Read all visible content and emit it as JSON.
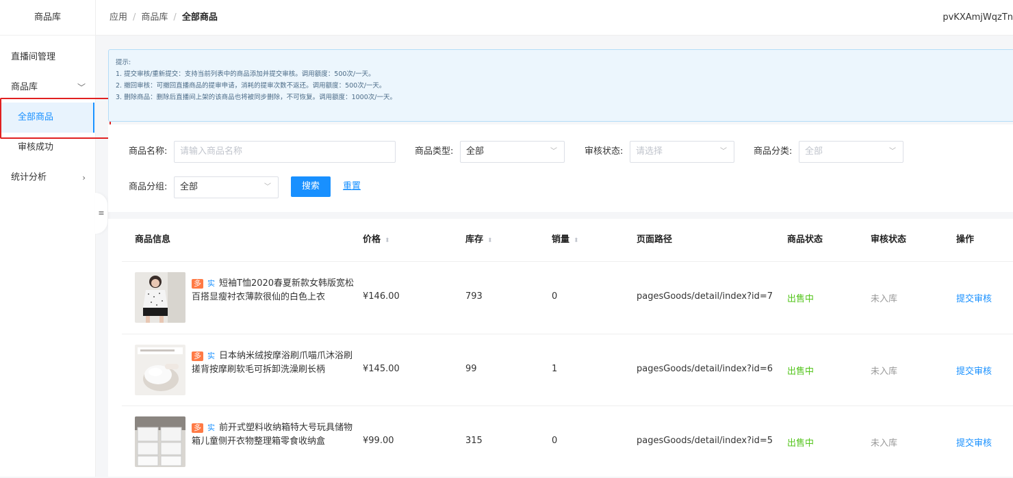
{
  "sidebar": {
    "title": "商品库",
    "items": [
      {
        "label": "直播间管理"
      },
      {
        "label": "商品库",
        "arrow": "﹀"
      },
      {
        "label": "全部商品"
      },
      {
        "label": "审核成功"
      },
      {
        "label": "统计分析",
        "arrow": "›"
      }
    ],
    "collapse_icon": "≡"
  },
  "header": {
    "breadcrumb": [
      "应用",
      "商品库",
      "全部商品"
    ],
    "separator": "/",
    "account": "pvKXAmjWqzTn"
  },
  "tips": {
    "title": "提示:",
    "lines": [
      "1. 提交审核/重新提交：支持当前列表中的商品添加并提交审核。调用额度：500次/一天。",
      "2. 撤回审核：可撤回直播商品的提审申请，消耗的提审次数不返还。调用额度：500次/一天。",
      "3. 删除商品：删除后直播间上架的该商品也将被同步删除，不可恢复。调用额度：1000次/一天。"
    ]
  },
  "filters": {
    "name_label": "商品名称:",
    "name_placeholder": "请输入商品名称",
    "type_label": "商品类型:",
    "type_value": "全部",
    "audit_label": "审核状态:",
    "audit_placeholder": "请选择",
    "category_label": "商品分类:",
    "category_placeholder": "全部",
    "group_label": "商品分组:",
    "group_value": "全部",
    "search_button": "搜索",
    "reset_button": "重置"
  },
  "table": {
    "columns": [
      "商品信息",
      "价格",
      "库存",
      "销量",
      "页面路径",
      "商品状态",
      "审核状态",
      "操作"
    ],
    "rows": [
      {
        "tag1": "多",
        "tag2": "实",
        "title": "短袖T恤2020春夏新款女韩版宽松百搭显瘦衬衣薄款很仙的白色上衣",
        "price": "¥146.00",
        "stock": "793",
        "sales": "0",
        "path": "pagesGoods/detail/index?id=7",
        "status": "出售中",
        "audit": "未入库",
        "action": "提交审核"
      },
      {
        "tag1": "多",
        "tag2": "实",
        "title": "日本纳米绒按摩浴刷爪喵爪沐浴刷搓背按摩刷软毛可拆卸洗澡刷长柄",
        "price": "¥145.00",
        "stock": "99",
        "sales": "1",
        "path": "pagesGoods/detail/index?id=6",
        "status": "出售中",
        "audit": "未入库",
        "action": "提交审核"
      },
      {
        "tag1": "多",
        "tag2": "实",
        "title": "前开式塑料收纳箱特大号玩具储物箱儿童侧开衣物整理箱零食收纳盒",
        "price": "¥99.00",
        "stock": "315",
        "sales": "0",
        "path": "pagesGoods/detail/index?id=5",
        "status": "出售中",
        "audit": "未入库",
        "action": "提交审核"
      }
    ]
  },
  "colors": {
    "accent": "#1890ff",
    "status_green": "#52c41a",
    "highlight_red": "#e02020"
  }
}
